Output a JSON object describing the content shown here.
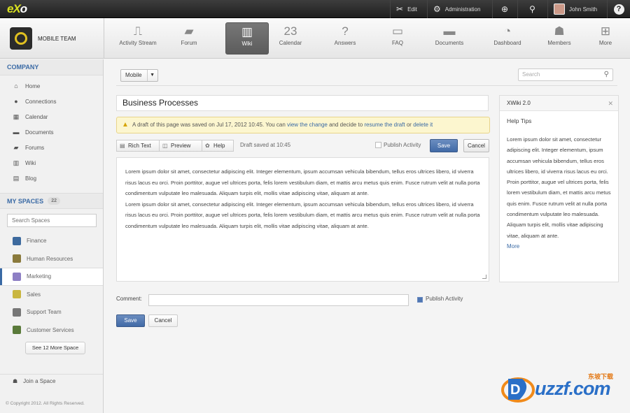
{
  "topbar": {
    "logo_e": "eX",
    "logo_o": "o",
    "edit": "Edit",
    "administration": "Administration",
    "user_name": "John Smith"
  },
  "space": {
    "name": "MOBILE TEAM",
    "apps": [
      {
        "label": "Activity Stream",
        "icon": "activity-stream-icon"
      },
      {
        "label": "Forum",
        "icon": "forum-icon"
      },
      {
        "label": "Wiki",
        "icon": "wiki-icon"
      },
      {
        "label": "Calendar",
        "icon": "calendar-icon",
        "badge": "23"
      },
      {
        "label": "Answers",
        "icon": "answers-icon"
      },
      {
        "label": "FAQ",
        "icon": "faq-icon"
      },
      {
        "label": "Documents",
        "icon": "documents-icon"
      },
      {
        "label": "Dashboard",
        "icon": "dashboard-icon"
      },
      {
        "label": "Members",
        "icon": "members-icon"
      },
      {
        "label": "More",
        "icon": "more-icon"
      }
    ]
  },
  "sidebar": {
    "company_title": "COMPANY",
    "company_items": [
      "Home",
      "Connections",
      "Calendar",
      "Documents",
      "Forums",
      "Wiki",
      "Blog"
    ],
    "my_spaces_title": "MY SPACES",
    "spaces_count": "22",
    "search_placeholder": "Search Spaces",
    "spaces": [
      "Finance",
      "Human Resources",
      "Marketing",
      "Sales",
      "Support Team",
      "Customer Services"
    ],
    "see_more": "See 12 More Space",
    "join": "Join a Space",
    "copyright": "© Copyright 2012. All Rights Reserved."
  },
  "wiki": {
    "select_value": "Mobile",
    "search_placeholder": "Search",
    "page_title": "Business Processes",
    "draft_msg": "A draft of this page was saved on Jul 17, 2012 10:45. You can ",
    "draft_link1": "view the change",
    "draft_mid": " and decide to ",
    "draft_link2": "resume the draft",
    "draft_or": " or ",
    "draft_link3": "delete it",
    "btn_rich_text": "Rich Text",
    "btn_preview": "Preview",
    "btn_help": "Help",
    "draft_saved": "Draft saved at 10:45",
    "publish_activity": "Publish Activity",
    "save": "Save",
    "cancel": "Cancel",
    "content": [
      "Lorem ipsum dolor sit amet, consectetur adipiscing elit. Integer elementum, ipsum accumsan vehicula bibendum, tellus eros ultrices libero, id viverra risus lacus eu orci. Proin porttitor, augue vel ultrices porta, felis lorem vestibulum diam, et mattis arcu metus quis enim. Fusce rutrum velit at nulla porta condimentum vulputate leo malesuada. Aliquam turpis elit, mollis vitae adipiscing vitae, aliquam at ante.",
      "Lorem ipsum dolor sit amet, consectetur adipiscing elit. Integer elementum, ipsum accumsan vehicula bibendum, tellus eros ultrices libero, id viverra risus lacus eu orci. Proin porttitor, augue vel ultrices porta, felis lorem vestibulum diam, et mattis arcu metus quis enim. Fusce rutrum velit at nulla porta condimentum vulputate leo malesuada. Aliquam turpis elit, mollis vitae adipiscing vitae, aliquam at ante."
    ],
    "comment_label": "Comment:",
    "comment_publish": "Publish Activity",
    "comment_save": "Save",
    "comment_cancel": "Cancel"
  },
  "help_panel": {
    "header": "XWiki 2.0",
    "title": "Help Tips",
    "body": "Lorem ipsum dolor sit amet, consectetur adipiscing elit. Integer elementum, ipsum accumsan vehicula bibendum, tellus eros ultrices libero, id viverra risus lacus eu orci. Proin porttitor, augue vel ultrices porta, felis lorem vestibulum diam, et mattis arcu metus quis enim. Fusce rutrum velit at nulla porta condimentum vulputate leo malesuada. Aliquam turpis elit, mollis vitae adipiscing vitae, aliquam at ante.",
    "more": "More"
  },
  "watermark": {
    "text": "uzzf.com",
    "cn": "东坡下载"
  },
  "colors": {
    "accent": "#3a6aa5",
    "warning_bg": "#fcf6cf",
    "save_button": "#416aa6"
  }
}
